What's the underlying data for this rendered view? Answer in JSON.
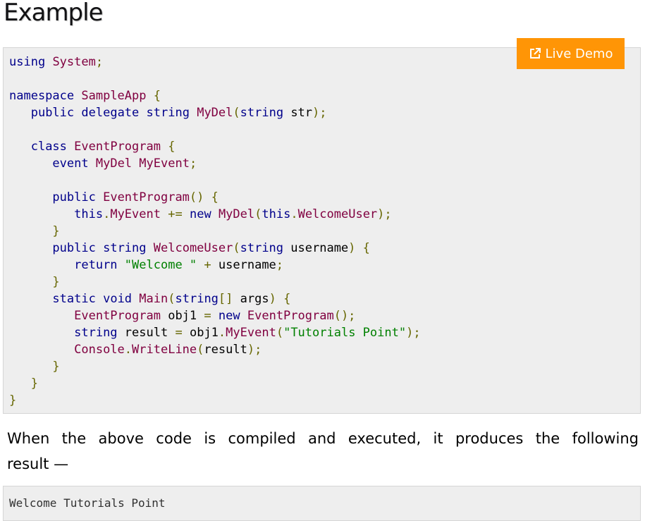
{
  "heading": "Example",
  "live_demo": {
    "label": "Live Demo",
    "icon": "external-link-icon"
  },
  "code": {
    "l1_a": "using",
    "l1_b": "System",
    "l3_a": "namespace",
    "l3_b": "SampleApp",
    "l4_a": "public",
    "l4_b": "delegate",
    "l4_c": "string",
    "l4_d": "MyDel",
    "l4_e": "string",
    "l4_f": "str",
    "l6_a": "class",
    "l6_b": "EventProgram",
    "l7_a": "event",
    "l7_b": "MyDel",
    "l7_c": "MyEvent",
    "l9_a": "public",
    "l9_b": "EventProgram",
    "l10_a": "this",
    "l10_b": "MyEvent",
    "l10_c": "new",
    "l10_d": "MyDel",
    "l10_e": "this",
    "l10_f": "WelcomeUser",
    "l12_a": "public",
    "l12_b": "string",
    "l12_c": "WelcomeUser",
    "l12_d": "string",
    "l12_e": "username",
    "l13_a": "return",
    "l13_b": "\"Welcome \"",
    "l13_c": "username",
    "l15_a": "static",
    "l15_b": "void",
    "l15_c": "Main",
    "l15_d": "string",
    "l15_e": "args",
    "l16_a": "EventProgram",
    "l16_b": "obj1",
    "l16_c": "new",
    "l16_d": "EventProgram",
    "l17_a": "string",
    "l17_b": "result",
    "l17_c": "obj1",
    "l17_d": "MyEvent",
    "l17_e": "\"Tutorials Point\"",
    "l18_a": "Console",
    "l18_b": "WriteLine",
    "l18_c": "result"
  },
  "paragraph": {
    "line1": "When the above code is compiled and executed, it produces the following",
    "line2": "result —"
  },
  "output": "Welcome Tutorials Point"
}
